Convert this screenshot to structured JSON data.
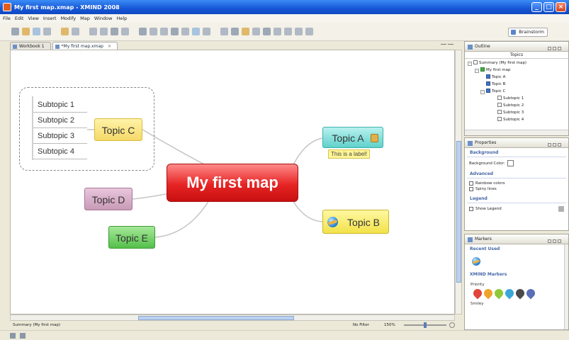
{
  "window": {
    "title": "My first map.xmap - XMIND 2008"
  },
  "menu": [
    "File",
    "Edit",
    "View",
    "Insert",
    "Modify",
    "Map",
    "Window",
    "Help"
  ],
  "toolbar": {
    "brainstorm_label": "Brainstorm"
  },
  "editor_tabs": [
    {
      "label": "Workbook 1",
      "active": false
    },
    {
      "label": "*My first map.xmap",
      "active": true
    }
  ],
  "map": {
    "central": "My first map",
    "topics": {
      "a": {
        "label": "Topic A",
        "note_label": "This is a label!",
        "color": "#5fd1cb"
      },
      "b": {
        "label": "Topic B",
        "color": "#f2e24a",
        "marker": "globe-icon"
      },
      "c": {
        "label": "Topic C",
        "color": "#f5d968"
      },
      "d": {
        "label": "Topic D",
        "color": "#c89ab6"
      },
      "e": {
        "label": "Topic E",
        "color": "#54c04a"
      }
    },
    "subtopics": [
      "Subtopic 1",
      "Subtopic 2",
      "Subtopic 3",
      "Subtopic 4"
    ],
    "central_color": "#e62424"
  },
  "status": {
    "selection": "Summary (My first map)",
    "filter": "No Filter",
    "zoom": "150%"
  },
  "outline": {
    "title": "Outline",
    "column": "Topics",
    "items": [
      "Summary (My first map)",
      "My first map",
      "Topic A",
      "Topic B",
      "Topic C",
      "Subtopic 1",
      "Subtopic 2",
      "Subtopic 3",
      "Subtopic 4"
    ]
  },
  "properties": {
    "title": "Properties",
    "background_section": "Background",
    "background_color_label": "Background Color:",
    "advanced_section": "Advanced",
    "rainbow_label": "Rainbow colors",
    "spiny_label": "Spiny lines",
    "legend_section": "Legend",
    "show_legend_label": "Show Legend"
  },
  "markers": {
    "title": "Markers",
    "recent_section": "Recent Used",
    "xmind_section": "XMIND Markers",
    "priority_label": "Priority",
    "smiley_label": "Smiley",
    "priority_colors": [
      "#e0443a",
      "#f0a32a",
      "#8fc93a",
      "#3aa7d8",
      "#4a4a4a",
      "#5b6fb8"
    ]
  }
}
